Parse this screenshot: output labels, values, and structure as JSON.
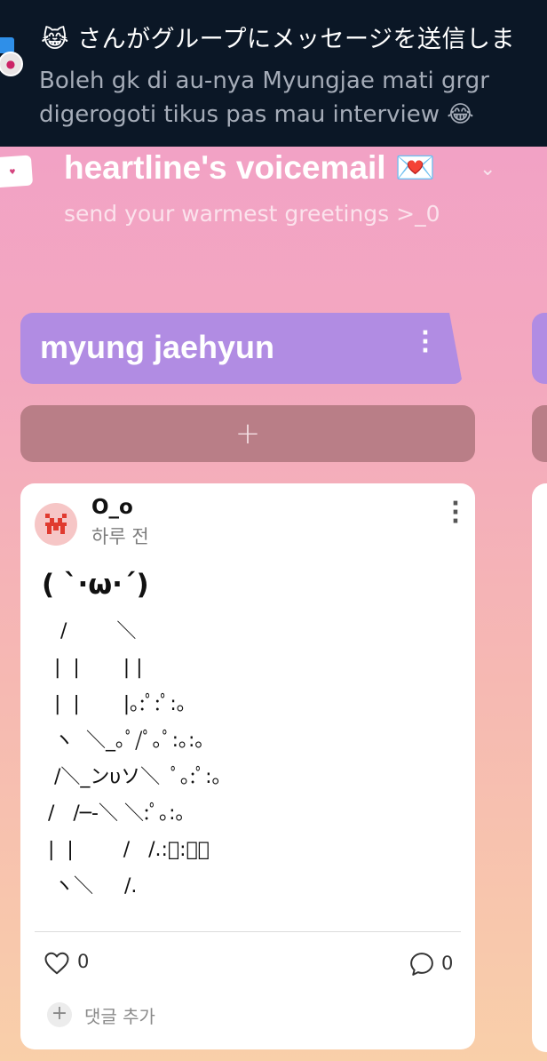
{
  "notification": {
    "title": "😹 さんがグループにメッセージを送信しま",
    "body": "Boleh gk di au-nya Myungjae mati grgr digerogoti tikus pas mau interview 😂",
    "avatar_icon": "user-avatar",
    "app_icon": "messenger-icon"
  },
  "board": {
    "title": "heartline's voicemail 💌",
    "subtitle": "send your warmest greetings >_0",
    "chevron": "⌄"
  },
  "section": {
    "title": "myung jaehyun",
    "menu_glyph": "⋮",
    "add_glyph": "+"
  },
  "post": {
    "author": "O_o",
    "time": "하루 전",
    "heading": "( ˋ·ω·ˊ)",
    "art": "   /        ＼\n  |  |       | |\n  |  |       |｡:ﾟ:ﾟ:｡\n  ヽ  ＼_｡ﾟ/ﾟ｡ﾟ:｡:｡\n  /＼_ンυソ＼  ﾟ｡:ﾟ:｡\n /   /─-＼ ＼:ﾟ｡:｡\n |  |        /   /.:ﾟ:ﾟ｡\n  ヽ＼     /.",
    "likes": "0",
    "comments": "0",
    "add_comment_label": "댓글 추가",
    "add_comment_glyph": "+",
    "menu_glyph": "⋮"
  },
  "colors": {
    "section_header": "#b18ce3",
    "add_button": "#b97e87",
    "notification_bg": "#0b1726"
  }
}
